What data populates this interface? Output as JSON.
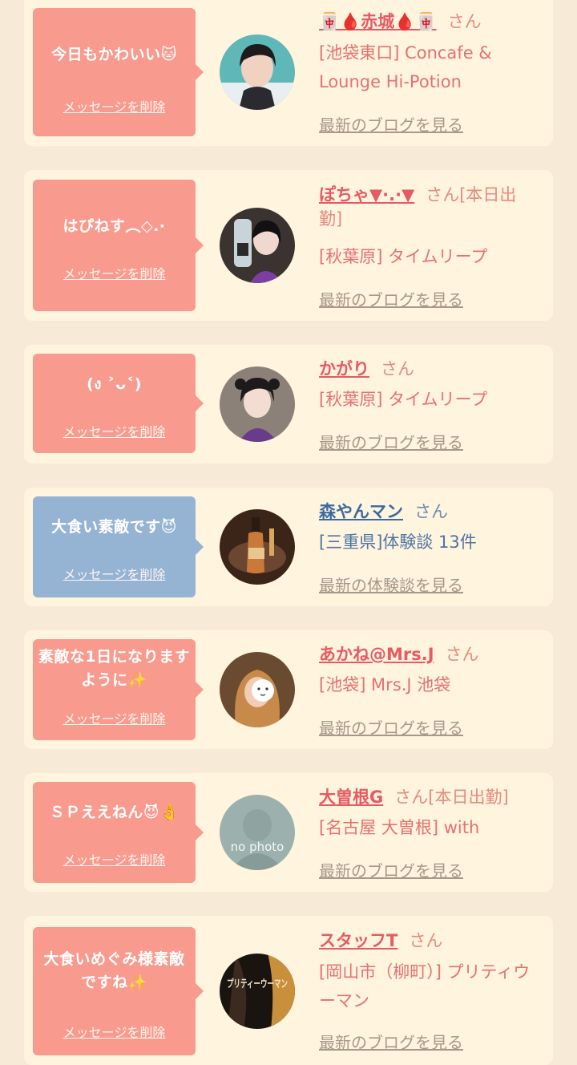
{
  "cards": [
    {
      "message": "今日もかわいい🐱",
      "delete_label": "メッセージを削除",
      "name": "🀄🩸赤城🩸🀄",
      "honorific": "さん",
      "shop": "[池袋東口] Concafe & Lounge Hi-Potion",
      "link": "最新のブログを見る",
      "theme": "pink"
    },
    {
      "message": "はぴねす︵◇.·",
      "delete_label": "メッセージを削除",
      "name": "ぽちゃ▼·.·▼",
      "honorific": "さん[本日出勤]",
      "shop": "[秋葉原] タイムリープ",
      "link": "最新のブログを見る",
      "theme": "pink"
    },
    {
      "message": "(ง ˃ᴗ˂)",
      "delete_label": "メッセージを削除",
      "name": "かがり",
      "honorific": "さん",
      "shop": "[秋葉原] タイムリープ",
      "link": "最新のブログを見る",
      "theme": "pink"
    },
    {
      "message": "大食い素敵です😈",
      "delete_label": "メッセージを削除",
      "name": "森やんマン",
      "honorific": "さん",
      "shop": "[三重県]体験談 13件",
      "link": "最新の体験談を見る",
      "theme": "blue"
    },
    {
      "message": "素敵な1日になりますように✨",
      "delete_label": "メッセージを削除",
      "name": "あかね@Mrs.J",
      "honorific": "さん",
      "shop": "[池袋] Mrs.J 池袋",
      "link": "最新のブログを見る",
      "theme": "pink"
    },
    {
      "message": "ＳＰええねん😈👌",
      "delete_label": "メッセージを削除",
      "name": "大曽根G",
      "honorific": "さん[本日出勤]",
      "shop": "[名古屋 大曽根] with",
      "link": "最新のブログを見る",
      "theme": "pink",
      "avatar_text": "no photo"
    },
    {
      "message": "大食いめぐみ様素敵ですね✨",
      "delete_label": "メッセージを削除",
      "name": "スタッフT",
      "honorific": "さん",
      "shop": "[岡山市（柳町）] プリティウーマン",
      "link": "最新のブログを見る",
      "theme": "pink",
      "avatar_text": "プリティーウーマン"
    }
  ]
}
